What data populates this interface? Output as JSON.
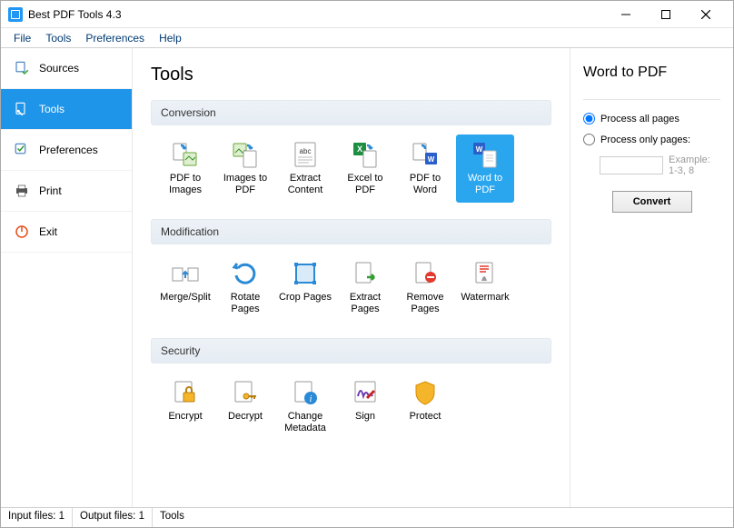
{
  "window": {
    "title": "Best PDF Tools 4.3"
  },
  "menu": {
    "file": "File",
    "tools": "Tools",
    "preferences": "Preferences",
    "help": "Help"
  },
  "sidebar": {
    "sources": "Sources",
    "tools": "Tools",
    "preferences": "Preferences",
    "print": "Print",
    "exit": "Exit"
  },
  "main": {
    "heading": "Tools",
    "sections": {
      "conversion": {
        "title": "Conversion",
        "t0": "PDF to Images",
        "t1": "Images to PDF",
        "t2": "Extract Content",
        "t3": "Excel to PDF",
        "t4": "PDF to Word",
        "t5": "Word to PDF"
      },
      "modification": {
        "title": "Modification",
        "t0": "Merge/Split",
        "t1": "Rotate Pages",
        "t2": "Crop Pages",
        "t3": "Extract Pages",
        "t4": "Remove Pages",
        "t5": "Watermark"
      },
      "security": {
        "title": "Security",
        "t0": "Encrypt",
        "t1": "Decrypt",
        "t2": "Change Metadata",
        "t3": "Sign",
        "t4": "Protect"
      }
    }
  },
  "right": {
    "heading": "Word to PDF",
    "opt_all": "Process all pages",
    "opt_only": "Process only pages:",
    "pages_value": "",
    "pages_hint": "Example: 1-3, 8",
    "convert": "Convert"
  },
  "status": {
    "input": "Input files: 1",
    "output": "Output files: 1",
    "context": "Tools"
  },
  "colors": {
    "accent": "#1f95e9"
  }
}
